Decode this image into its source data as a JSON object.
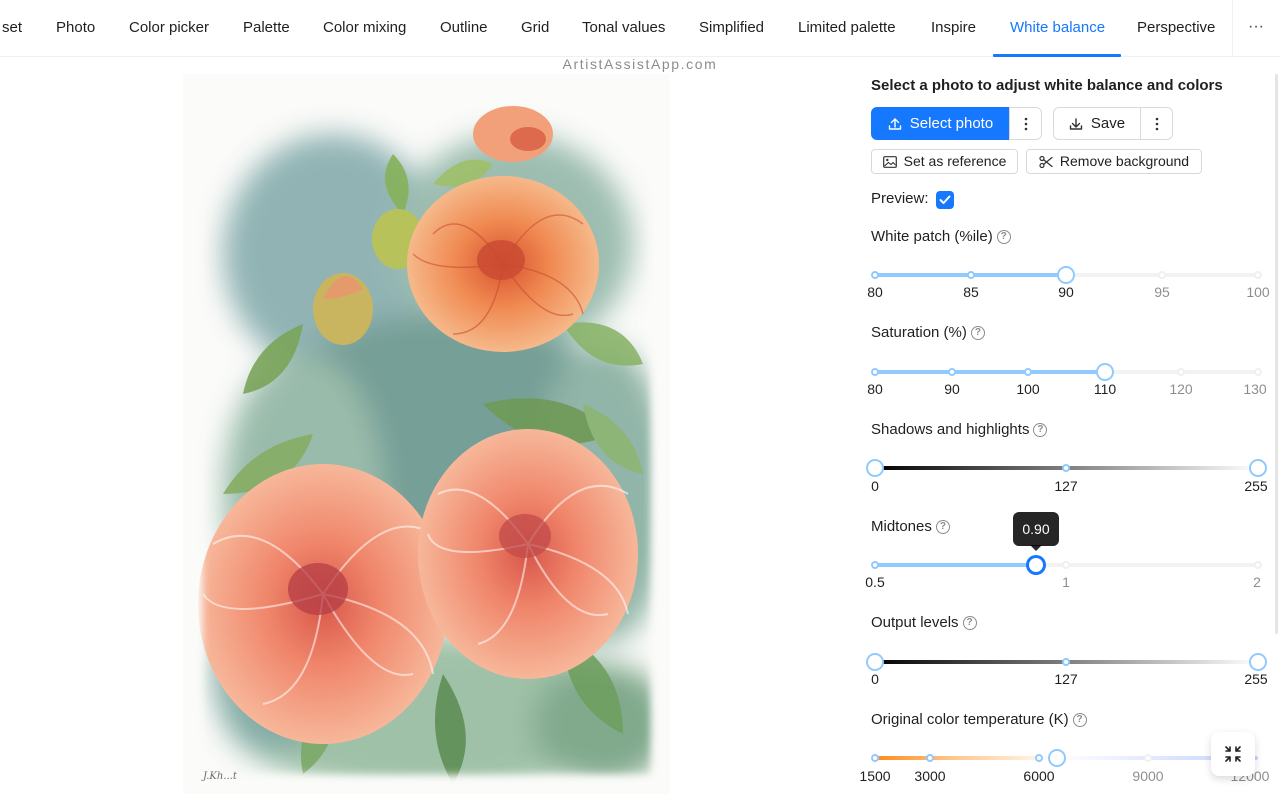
{
  "tabs": [
    {
      "label": "set"
    },
    {
      "label": "Photo"
    },
    {
      "label": "Color picker"
    },
    {
      "label": "Palette"
    },
    {
      "label": "Color mixing"
    },
    {
      "label": "Outline"
    },
    {
      "label": "Grid"
    },
    {
      "label": "Tonal values"
    },
    {
      "label": "Simplified"
    },
    {
      "label": "Limited palette"
    },
    {
      "label": "Inspire"
    },
    {
      "label": "White balance",
      "active": true
    },
    {
      "label": "Perspective"
    }
  ],
  "more_tabs_label": "···",
  "brand": "ArtistAssistApp.com",
  "image_signature": "J.Kh...t",
  "panel": {
    "title": "Select a photo to adjust white balance and colors",
    "select_photo": "Select photo",
    "save": "Save",
    "set_as_reference": "Set as reference",
    "remove_background": "Remove background",
    "preview_label": "Preview",
    "preview_checked": true
  },
  "sliders": {
    "white_patch": {
      "label": "White patch (%ile)",
      "marks": [
        "80",
        "85",
        "90",
        "95",
        "100"
      ],
      "value": 90
    },
    "saturation": {
      "label": "Saturation (%)",
      "marks": [
        "80",
        "90",
        "100",
        "110",
        "120",
        "130"
      ],
      "value": 110
    },
    "shadows_highlights": {
      "label": "Shadows and highlights",
      "marks": [
        "0",
        "127",
        "255"
      ],
      "value": [
        0,
        255
      ]
    },
    "midtones": {
      "label": "Midtones",
      "marks": [
        "0.5",
        "1",
        "2"
      ],
      "value": 0.9,
      "tooltip": "0.90"
    },
    "output_levels": {
      "label": "Output levels",
      "marks": [
        "0",
        "127",
        "255"
      ],
      "value": [
        0,
        255
      ]
    },
    "color_temperature": {
      "label": "Original color temperature (K)",
      "marks": [
        "1500",
        "3000",
        "6000",
        "9000",
        "12000"
      ],
      "value": 6500
    }
  },
  "colors": {
    "accent": "#1677ff",
    "track": "#91caff"
  }
}
